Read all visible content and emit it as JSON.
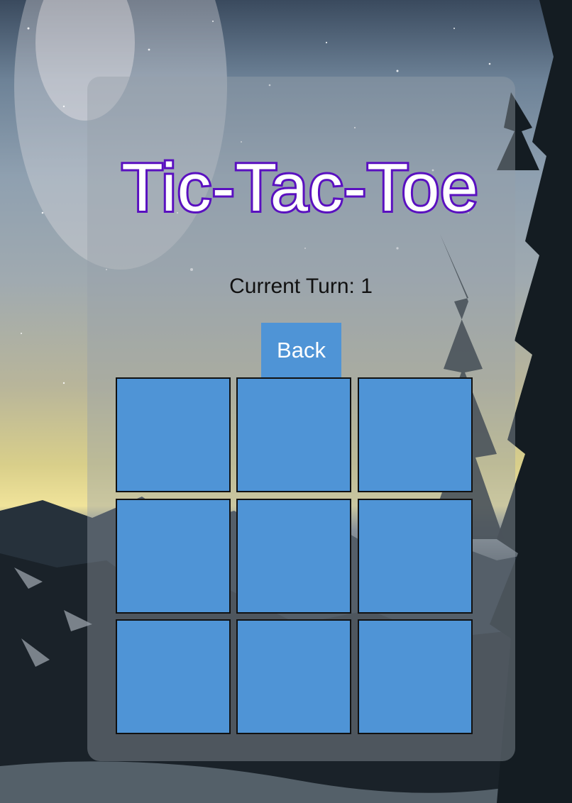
{
  "game": {
    "title": "Tic-Tac-Toe",
    "turn_label": "Current Turn:",
    "turn_value": "1",
    "back_label": "Back"
  },
  "board": {
    "cells": [
      "",
      "",
      "",
      "",
      "",
      "",
      "",
      "",
      ""
    ]
  },
  "colors": {
    "title_stroke": "#5a10c0",
    "title_fill": "#ffffff",
    "cell": "#4f94d6",
    "button": "#4f94d6"
  }
}
